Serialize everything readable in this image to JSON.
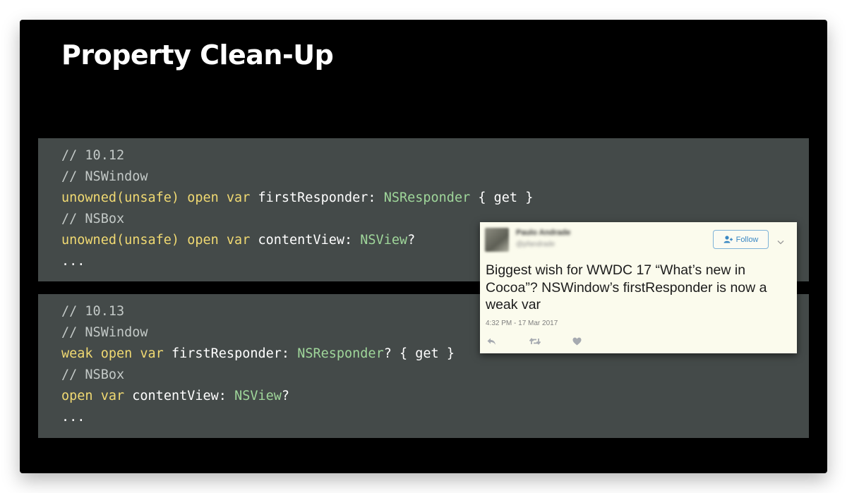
{
  "slide": {
    "title": "Property Clean-Up"
  },
  "code_before": [
    [
      {
        "t": "c",
        "v": "// 10.12"
      }
    ],
    [
      {
        "t": "c",
        "v": "// NSWindow"
      }
    ],
    [
      {
        "t": "k",
        "v": "unowned(unsafe)"
      },
      {
        "t": "p",
        "v": " "
      },
      {
        "t": "k",
        "v": "open"
      },
      {
        "t": "p",
        "v": " "
      },
      {
        "t": "k",
        "v": "var"
      },
      {
        "t": "p",
        "v": " firstResponder: "
      },
      {
        "t": "t",
        "v": "NSResponder"
      },
      {
        "t": "p",
        "v": " { get }"
      }
    ],
    [
      {
        "t": "c",
        "v": "// NSBox"
      }
    ],
    [
      {
        "t": "k",
        "v": "unowned(unsafe)"
      },
      {
        "t": "p",
        "v": " "
      },
      {
        "t": "k",
        "v": "open"
      },
      {
        "t": "p",
        "v": " "
      },
      {
        "t": "k",
        "v": "var"
      },
      {
        "t": "p",
        "v": " contentView: "
      },
      {
        "t": "t",
        "v": "NSView"
      },
      {
        "t": "p",
        "v": "?"
      }
    ],
    [
      {
        "t": "p",
        "v": "..."
      }
    ]
  ],
  "code_after": [
    [
      {
        "t": "c",
        "v": "// 10.13"
      }
    ],
    [
      {
        "t": "c",
        "v": "// NSWindow"
      }
    ],
    [
      {
        "t": "k",
        "v": "weak"
      },
      {
        "t": "p",
        "v": " "
      },
      {
        "t": "k",
        "v": "open"
      },
      {
        "t": "p",
        "v": " "
      },
      {
        "t": "k",
        "v": "var"
      },
      {
        "t": "p",
        "v": " firstResponder: "
      },
      {
        "t": "t",
        "v": "NSResponder"
      },
      {
        "t": "p",
        "v": "? { get }"
      }
    ],
    [
      {
        "t": "c",
        "v": "// NSBox"
      }
    ],
    [
      {
        "t": "k",
        "v": "open"
      },
      {
        "t": "p",
        "v": " "
      },
      {
        "t": "k",
        "v": "var"
      },
      {
        "t": "p",
        "v": " contentView: "
      },
      {
        "t": "t",
        "v": "NSView"
      },
      {
        "t": "p",
        "v": "?"
      }
    ],
    [
      {
        "t": "p",
        "v": "..."
      }
    ]
  ],
  "tweet": {
    "author_name": "Paulo Andrade",
    "author_handle": "@pfandrade",
    "follow_label": "Follow",
    "text": "Biggest wish for WWDC 17 “What’s new in Cocoa”? NSWindow’s firstResponder is now a weak var",
    "timestamp": "4:32 PM - 17 Mar 2017",
    "icons": [
      "reply-icon",
      "retweet-icon",
      "like-icon",
      "person-add-icon",
      "chevron-down-icon"
    ]
  },
  "colors": {
    "slide_bg": "#000000",
    "code_bg": "#444a49",
    "keyword": "#f0d972",
    "type": "#9fd69a",
    "comment": "#c3c9c7",
    "tweet_bg": "#fbfbed",
    "follow_blue": "#3b88c3"
  }
}
